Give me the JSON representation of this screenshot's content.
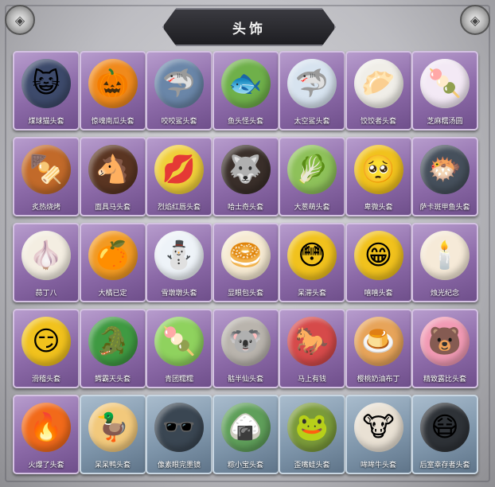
{
  "header": {
    "title": "头饰"
  },
  "colors": {
    "card_purple": "#8c6aa8",
    "card_blue": "#7f96ab",
    "banner": "#2a2a30"
  },
  "items": [
    {
      "label": "煤球猫头套",
      "icon": "cat-head-icon",
      "glyph": "😺",
      "bg": "#3d4a6b",
      "style": "purple"
    },
    {
      "label": "惊魂南瓜头套",
      "icon": "pumpkin-head-icon",
      "glyph": "🎃",
      "bg": "#f08a1c",
      "style": "purple"
    },
    {
      "label": "咬咬鲨头套",
      "icon": "shark-head-icon",
      "glyph": "🦈",
      "bg": "#6a86a8",
      "style": "purple"
    },
    {
      "label": "鱼头怪头套",
      "icon": "fish-monster-head-icon",
      "glyph": "🐟",
      "bg": "#6fb04a",
      "style": "purple"
    },
    {
      "label": "太空鲨头套",
      "icon": "space-shark-head-icon",
      "glyph": "🦈",
      "bg": "#d7e3ef",
      "style": "purple"
    },
    {
      "label": "饺饺者头套",
      "icon": "dumpling-head-icon",
      "glyph": "🥟",
      "bg": "#f0eee8",
      "style": "purple"
    },
    {
      "label": "芝麻糯汤圆",
      "icon": "rice-ball-head-icon",
      "glyph": "🍡",
      "bg": "#f3e9f5",
      "style": "purple"
    },
    {
      "label": "炙热烧烤",
      "icon": "bbq-head-icon",
      "glyph": "🍢",
      "bg": "#c26a2a",
      "style": "purple"
    },
    {
      "label": "面具马头套",
      "icon": "horse-head-icon",
      "glyph": "🐴",
      "bg": "#5a3522",
      "style": "purple"
    },
    {
      "label": "烈焰红唇头套",
      "icon": "lips-head-icon",
      "glyph": "💋",
      "bg": "#f0cf3a",
      "style": "purple"
    },
    {
      "label": "哈士奇头套",
      "icon": "husky-head-icon",
      "glyph": "🐺",
      "bg": "#3a2f2a",
      "style": "purple"
    },
    {
      "label": "大葱萌头套",
      "icon": "green-onion-head-icon",
      "glyph": "🥬",
      "bg": "#8ec15a",
      "style": "purple"
    },
    {
      "label": "卑微头套",
      "icon": "humble-emoji-head-icon",
      "glyph": "🥺",
      "bg": "#f1c21d",
      "style": "purple"
    },
    {
      "label": "萨卡斑甲鱼头套",
      "icon": "armored-fish-head-icon",
      "glyph": "🐡",
      "bg": "#46505c",
      "style": "purple"
    },
    {
      "label": "蒜丁八",
      "icon": "garlic-head-icon",
      "glyph": "🧄",
      "bg": "#f4eee2",
      "style": "purple"
    },
    {
      "label": "大橘已定",
      "icon": "orange-head-icon",
      "glyph": "🍊",
      "bg": "#f29a22",
      "style": "purple"
    },
    {
      "label": "雪墩墩头套",
      "icon": "snowman-head-icon",
      "glyph": "⛄",
      "bg": "#eef3f8",
      "style": "purple"
    },
    {
      "label": "显眼包头套",
      "icon": "bun-head-icon",
      "glyph": "🥯",
      "bg": "#f6ead2",
      "style": "purple"
    },
    {
      "label": "呆滞头套",
      "icon": "dazed-emoji-head-icon",
      "glyph": "😳",
      "bg": "#f1c21d",
      "style": "purple"
    },
    {
      "label": "嘻嘻头套",
      "icon": "grin-emoji-head-icon",
      "glyph": "😁",
      "bg": "#f1c21d",
      "style": "purple"
    },
    {
      "label": "烛光纪念",
      "icon": "candle-head-icon",
      "glyph": "🕯️",
      "bg": "#f6ead8",
      "style": "purple"
    },
    {
      "label": "滑稽头套",
      "icon": "smirk-emoji-head-icon",
      "glyph": "😏",
      "bg": "#f1c21d",
      "style": "purple"
    },
    {
      "label": "鳄霸天头套",
      "icon": "crocodile-head-icon",
      "glyph": "🐊",
      "bg": "#3f9a42",
      "style": "purple"
    },
    {
      "label": "青团糯糯",
      "icon": "green-rice-cake-head-icon",
      "glyph": "🍡",
      "bg": "#8fd25e",
      "style": "purple"
    },
    {
      "label": "骷半仙头套",
      "icon": "koala-head-icon",
      "glyph": "🐨",
      "bg": "#b9b4ad",
      "style": "purple"
    },
    {
      "label": "马上有钱",
      "icon": "red-horse-head-icon",
      "glyph": "🐎",
      "bg": "#d64a4a",
      "style": "purple"
    },
    {
      "label": "樱桃奶油布丁",
      "icon": "pudding-head-icon",
      "glyph": "🍮",
      "bg": "#e7a45a",
      "style": "purple"
    },
    {
      "label": "精致露比头套",
      "icon": "pink-bear-head-icon",
      "glyph": "🐻",
      "bg": "#f19ab4",
      "style": "purple"
    },
    {
      "label": "火爆了头套",
      "icon": "fire-head-icon",
      "glyph": "🔥",
      "bg": "#f26a1a",
      "style": "purple"
    },
    {
      "label": "呆呆鸭头套",
      "icon": "duck-head-icon",
      "glyph": "🦆",
      "bg": "#f2c97c",
      "style": "blue"
    },
    {
      "label": "像素眼完墨镜",
      "icon": "pixel-sunglasses-icon",
      "glyph": "🕶️",
      "bg": "#3a4652",
      "style": "blue"
    },
    {
      "label": "粽小宝头套",
      "icon": "zongzi-head-icon",
      "glyph": "🍙",
      "bg": "#5f9f5a",
      "style": "blue"
    },
    {
      "label": "歪嘴蛙头套",
      "icon": "frog-head-icon",
      "glyph": "🐸",
      "bg": "#7a9a3a",
      "style": "blue"
    },
    {
      "label": "哞哞牛头套",
      "icon": "cow-head-icon",
      "glyph": "🐮",
      "bg": "#e9e1d4",
      "style": "blue"
    },
    {
      "label": "后室幸存者头套",
      "icon": "gas-mask-head-icon",
      "glyph": "😷",
      "bg": "#2e3237",
      "style": "blue"
    }
  ]
}
